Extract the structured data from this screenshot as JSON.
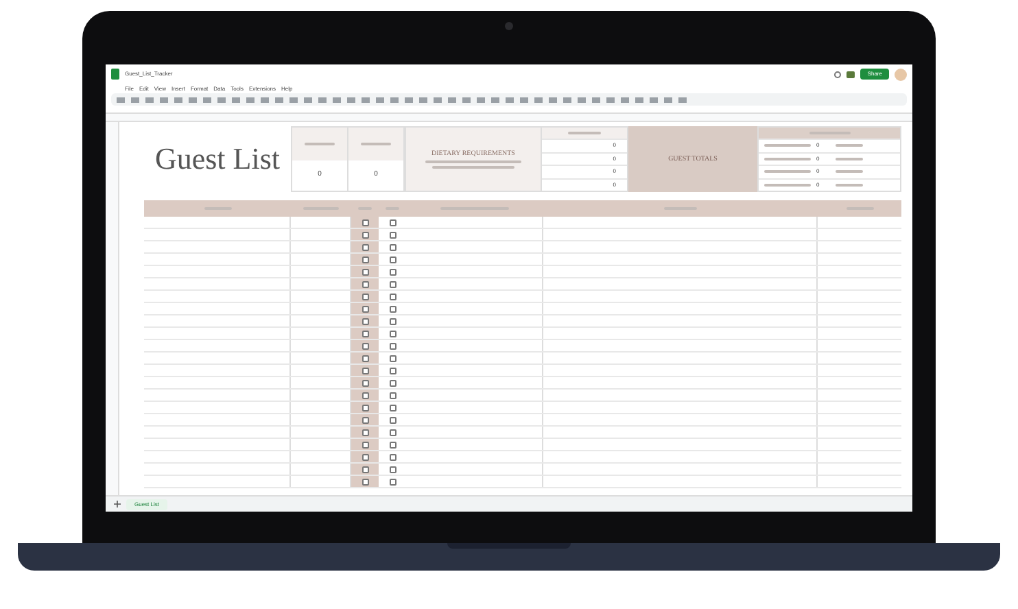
{
  "document_title": "Guest_List_Tracker",
  "menu": [
    "File",
    "Edit",
    "View",
    "Insert",
    "Format",
    "Data",
    "Tools",
    "Extensions",
    "Help"
  ],
  "share_button": "Share",
  "sheet_title": "Guest List",
  "counters": [
    {
      "value": "0"
    },
    {
      "value": "0"
    }
  ],
  "dietary": {
    "title": "DIETARY REQUIREMENTS"
  },
  "meal_totals": [
    "0",
    "0",
    "0",
    "0"
  ],
  "guest_totals": {
    "title": "GUEST TOTALS"
  },
  "rsvp_status": [
    "0",
    "0",
    "0",
    "0"
  ],
  "sheet_tabs": [
    {
      "label": "Guest List",
      "selected": true
    }
  ],
  "guest_rows": [
    {
      "checkboxes": [
        {
          "checked": false
        },
        {
          "checked": false
        }
      ]
    },
    {
      "checkboxes": [
        {
          "checked": false
        },
        {
          "checked": false
        }
      ]
    },
    {
      "checkboxes": [
        {
          "checked": false
        },
        {
          "checked": false
        }
      ]
    },
    {
      "checkboxes": [
        {
          "checked": false
        },
        {
          "checked": false
        }
      ]
    },
    {
      "checkboxes": [
        {
          "checked": false
        },
        {
          "checked": false
        }
      ]
    },
    {
      "checkboxes": [
        {
          "checked": false
        },
        {
          "checked": false
        }
      ]
    },
    {
      "checkboxes": [
        {
          "checked": false
        },
        {
          "checked": false
        }
      ]
    },
    {
      "checkboxes": [
        {
          "checked": false
        },
        {
          "checked": false
        }
      ]
    },
    {
      "checkboxes": [
        {
          "checked": false
        },
        {
          "checked": false
        }
      ]
    },
    {
      "checkboxes": [
        {
          "checked": false
        },
        {
          "checked": false
        }
      ]
    },
    {
      "checkboxes": [
        {
          "checked": false
        },
        {
          "checked": false
        }
      ]
    },
    {
      "checkboxes": [
        {
          "checked": false
        },
        {
          "checked": false
        }
      ]
    },
    {
      "checkboxes": [
        {
          "checked": false
        },
        {
          "checked": false
        }
      ]
    },
    {
      "checkboxes": [
        {
          "checked": false
        },
        {
          "checked": false
        }
      ]
    },
    {
      "checkboxes": [
        {
          "checked": false
        },
        {
          "checked": false
        }
      ]
    },
    {
      "checkboxes": [
        {
          "checked": false
        },
        {
          "checked": false
        }
      ]
    },
    {
      "checkboxes": [
        {
          "checked": false
        },
        {
          "checked": false
        }
      ]
    },
    {
      "checkboxes": [
        {
          "checked": false
        },
        {
          "checked": false
        }
      ]
    },
    {
      "checkboxes": [
        {
          "checked": false
        },
        {
          "checked": false
        }
      ]
    },
    {
      "checkboxes": [
        {
          "checked": false
        },
        {
          "checked": false
        }
      ]
    },
    {
      "checkboxes": [
        {
          "checked": false
        },
        {
          "checked": false
        }
      ]
    },
    {
      "checkboxes": [
        {
          "checked": false
        },
        {
          "checked": false
        }
      ]
    }
  ]
}
